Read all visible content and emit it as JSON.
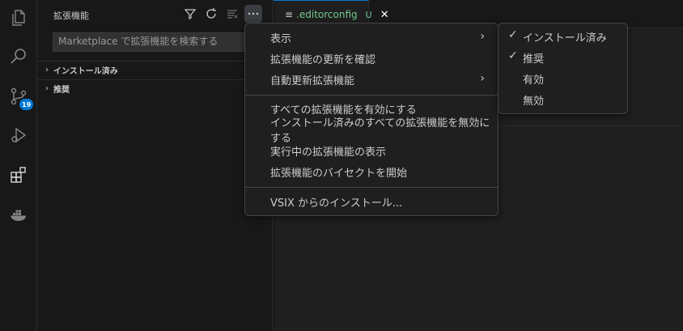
{
  "activity_bar": {
    "items": [
      {
        "icon": "files-icon"
      },
      {
        "icon": "search-icon"
      },
      {
        "icon": "source-control-icon",
        "badge": "19"
      },
      {
        "icon": "run-debug-icon"
      },
      {
        "icon": "extensions-icon"
      },
      {
        "icon": "docker-icon"
      }
    ]
  },
  "sidebar": {
    "title": "拡張機能",
    "search_placeholder": "Marketplace で拡張機能を検索する",
    "sections": [
      {
        "label": "インストール済み",
        "chevron": "›"
      },
      {
        "label": "推奨",
        "chevron": "›"
      }
    ]
  },
  "editor": {
    "tab": {
      "icon": "≡",
      "label": ".editorconfig",
      "status": "U",
      "close": "✕"
    }
  },
  "menu": {
    "items": [
      {
        "label": "表示",
        "submenu": "›"
      },
      {
        "label": "拡張機能の更新を確認"
      },
      {
        "label": "自動更新拡張機能",
        "submenu": "›"
      },
      {
        "label": "すべての拡張機能を有効にする"
      },
      {
        "label": "インストール済みのすべての拡張機能を無効にする"
      },
      {
        "label": "実行中の拡張機能の表示"
      },
      {
        "label": "拡張機能のバイセクトを開始"
      },
      {
        "label": "VSIX からのインストール..."
      }
    ]
  },
  "submenu": {
    "items": [
      {
        "label": "インストール済み",
        "check": "✓"
      },
      {
        "label": "推奨",
        "check": "✓"
      },
      {
        "label": "有効",
        "check": ""
      },
      {
        "label": "無効",
        "check": ""
      }
    ]
  },
  "colors": {
    "accent": "#0078d4",
    "untracked_green": "#73c991"
  }
}
